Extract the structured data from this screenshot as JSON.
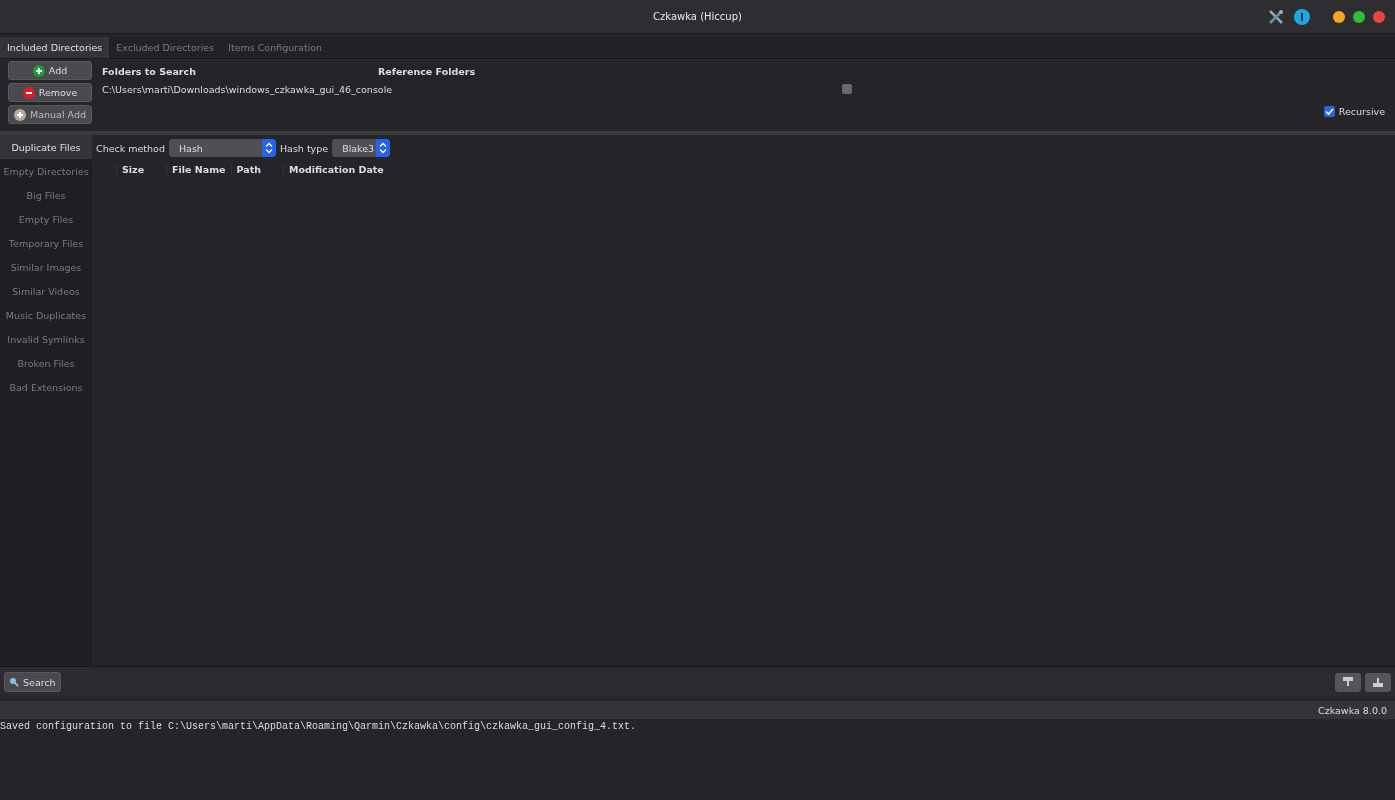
{
  "window": {
    "title": "Czkawka (Hiccup)"
  },
  "tabs": [
    {
      "label": "Included Directories",
      "selected": true
    },
    {
      "label": "Excluded Directories",
      "selected": false
    },
    {
      "label": "Items Configuration",
      "selected": false
    }
  ],
  "directory_buttons": [
    {
      "kind": "add",
      "label": "Add"
    },
    {
      "kind": "remove",
      "label": "Remove"
    },
    {
      "kind": "manual",
      "label": "Manual Add"
    }
  ],
  "folders": {
    "columns": [
      "Folders to Search",
      "Reference Folders"
    ],
    "rows": [
      {
        "path": "C:\\Users\\marti\\Downloads\\windows_czkawka_gui_46_console",
        "reference": false
      }
    ]
  },
  "recursive": {
    "label": "Recursive",
    "checked": true
  },
  "sidebar": {
    "items": [
      {
        "label": "Duplicate Files",
        "selected": true
      },
      {
        "label": "Empty Directories",
        "selected": false
      },
      {
        "label": "Big Files",
        "selected": false
      },
      {
        "label": "Empty Files",
        "selected": false
      },
      {
        "label": "Temporary Files",
        "selected": false
      },
      {
        "label": "Similar Images",
        "selected": false
      },
      {
        "label": "Similar Videos",
        "selected": false
      },
      {
        "label": "Music Duplicates",
        "selected": false
      },
      {
        "label": "Invalid Symlinks",
        "selected": false
      },
      {
        "label": "Broken Files",
        "selected": false
      },
      {
        "label": "Bad Extensions",
        "selected": false
      }
    ]
  },
  "options": [
    {
      "label": "Check method",
      "value": "Hash"
    },
    {
      "label": "Hash type",
      "value": "Blake3"
    }
  ],
  "results": {
    "columns": [
      "Size",
      "File Name",
      "Path",
      "Modification Date"
    ]
  },
  "search_button": {
    "label": "Search"
  },
  "status_bar": {
    "version": "Czkawka 8.0.0"
  },
  "log": "Saved configuration to file C:\\Users\\marti\\AppData\\Roaming\\Qarmin\\Czkawka\\config\\czkawka_gui_config_4.txt."
}
